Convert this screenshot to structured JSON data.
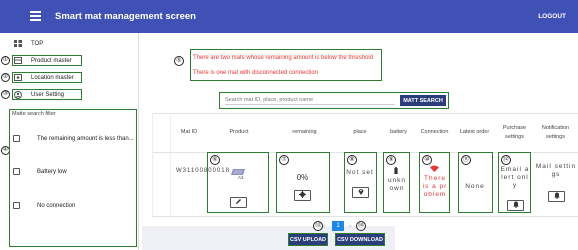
{
  "header": {
    "title": "Smart mat management screen",
    "logout_label": "LOGOUT"
  },
  "sidebar": {
    "items": [
      {
        "label": "TOP",
        "icon": "dashboard-icon",
        "marker": ""
      },
      {
        "label": "Product master",
        "icon": "product-icon",
        "marker": "①"
      },
      {
        "label": "Location master",
        "icon": "location-icon",
        "marker": "②"
      },
      {
        "label": "User Setting",
        "icon": "user-icon",
        "marker": "③"
      }
    ],
    "filter": {
      "marker": "④",
      "title": "Matte search filter",
      "options": [
        {
          "label": "The remaining amount is less than..."
        },
        {
          "label": "Battery low"
        },
        {
          "label": "No connection"
        }
      ]
    }
  },
  "alerts": {
    "marker": "⑤",
    "messages": [
      "There are two mats whose remaining amount is below the threshold",
      "There is one mat with disconnected connection"
    ]
  },
  "search": {
    "placeholder": "Search mat ID, place, product name",
    "button_label": "MATT SEARCH"
  },
  "table": {
    "columns": [
      "Mat ID",
      "Product",
      "remaining",
      "place",
      "battery",
      "Connection",
      "Latest order",
      "Purchase settings",
      "Notification settings"
    ],
    "row": {
      "mat_id": "W31100800018",
      "product_label": "A3",
      "remaining": "0%",
      "place": "Not set",
      "battery": "unknown",
      "connection": "There is a problem",
      "latest_order": "None",
      "purchase": "Email alert only",
      "notification": "Mail settings"
    },
    "markers": [
      "⑥",
      "⑦",
      "⑧",
      "⑨",
      "⑩",
      "⑪",
      "⑫"
    ]
  },
  "pagination": {
    "current_page": "1",
    "prev": "‹",
    "next": "›",
    "markers": [
      "⑬",
      "⑭"
    ]
  },
  "buttons": {
    "csv_upload": "CSV UPLOAD",
    "csv_download": "CSV DOWNLOAD"
  },
  "colors": {
    "appbar": "#3f51b5",
    "accent_button": "#2c3e7a",
    "alert_text": "#e53935",
    "annotation_box": "#2e7d32",
    "page_active": "#1e88e5"
  }
}
